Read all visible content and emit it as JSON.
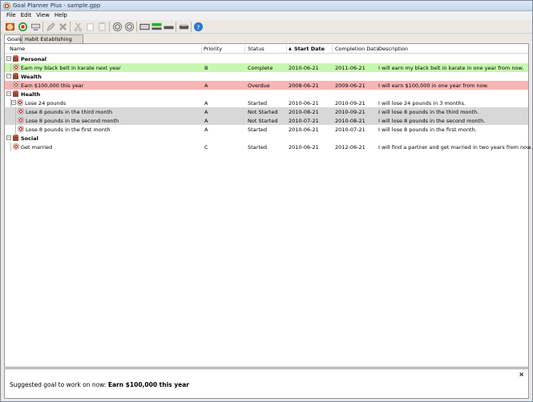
{
  "window": {
    "title": "Goal Planner Plus - sample.gpp"
  },
  "menu": [
    "File",
    "Edit",
    "View",
    "Help"
  ],
  "tabs": [
    {
      "label": "Goals",
      "active": true
    },
    {
      "label": "Habit Establishing Programs",
      "active": false
    }
  ],
  "columns": {
    "name": "Name",
    "priority": "Priority",
    "status": "Status",
    "start_date": "Start Date",
    "completion_date": "Completion Date",
    "description": "Description"
  },
  "sort_indicator": "▲",
  "rows": [
    {
      "type": "category",
      "name": "Personal"
    },
    {
      "type": "goal",
      "level": 1,
      "highlight": "green",
      "name": "Earn my black belt in karate next year",
      "priority": "B",
      "status": "Complete",
      "start": "2010-06-21",
      "completion": "2011-06-21",
      "description": "I will earn my black belt in karate in one year from now."
    },
    {
      "type": "category",
      "name": "Wealth"
    },
    {
      "type": "goal",
      "level": 1,
      "highlight": "red",
      "name": "Earn $100,000 this year",
      "priority": "A",
      "status": "Overdue",
      "start": "2008-06-21",
      "completion": "2009-06-21",
      "description": "I will earn $100,000 in one year from now."
    },
    {
      "type": "category",
      "name": "Health"
    },
    {
      "type": "goal",
      "level": 1,
      "highlight": "none",
      "expander": true,
      "name": "Lose 24 pounds",
      "priority": "A",
      "status": "Started",
      "start": "2010-06-21",
      "completion": "2010-09-21",
      "description": "I will lose 24 pounds in 3 months."
    },
    {
      "type": "goal",
      "level": 2,
      "highlight": "gray",
      "name": "Lose 8 pounds in the third month",
      "priority": "A",
      "status": "Not Started",
      "start": "2010-08-21",
      "completion": "2010-09-21",
      "description": "I will lose 8 pounds in the third month."
    },
    {
      "type": "goal",
      "level": 2,
      "highlight": "gray",
      "name": "Lose 8 pounds in the second month",
      "priority": "A",
      "status": "Not Started",
      "start": "2010-07-21",
      "completion": "2010-08-21",
      "description": "I will lose 8 pounds in the second month."
    },
    {
      "type": "goal",
      "level": 2,
      "highlight": "none",
      "name": "Lose 8 pounds in the first month",
      "priority": "A",
      "status": "Started",
      "start": "2010-06-21",
      "completion": "2010-07-21",
      "description": "I will lose 8 pounds in the first month."
    },
    {
      "type": "category",
      "name": "Social"
    },
    {
      "type": "goal",
      "level": 1,
      "highlight": "none",
      "name": "Get married",
      "priority": "C",
      "status": "Started",
      "start": "2010-06-21",
      "completion": "2012-06-21",
      "description": "I will find a partner and get married in two years from now."
    }
  ],
  "suggestion": {
    "prefix": "Suggested goal to work on now: ",
    "goal": "Earn $100,000 this year"
  },
  "close_glyph": "×",
  "toolbar_icons": [
    "new-goal-icon",
    "target-icon",
    "edit-goal-icon",
    "pencil-icon",
    "delete-icon",
    "cut-icon",
    "copy-icon",
    "paste-icon",
    "back-icon",
    "forward-icon",
    "progress-bar-icon",
    "green-bar-icon",
    "gray-bar-icon",
    "print-icon",
    "help-icon"
  ],
  "colors": {
    "complete": "#c8f7b0",
    "overdue": "#f7b5b5",
    "not_started": "#d8d8d8"
  }
}
